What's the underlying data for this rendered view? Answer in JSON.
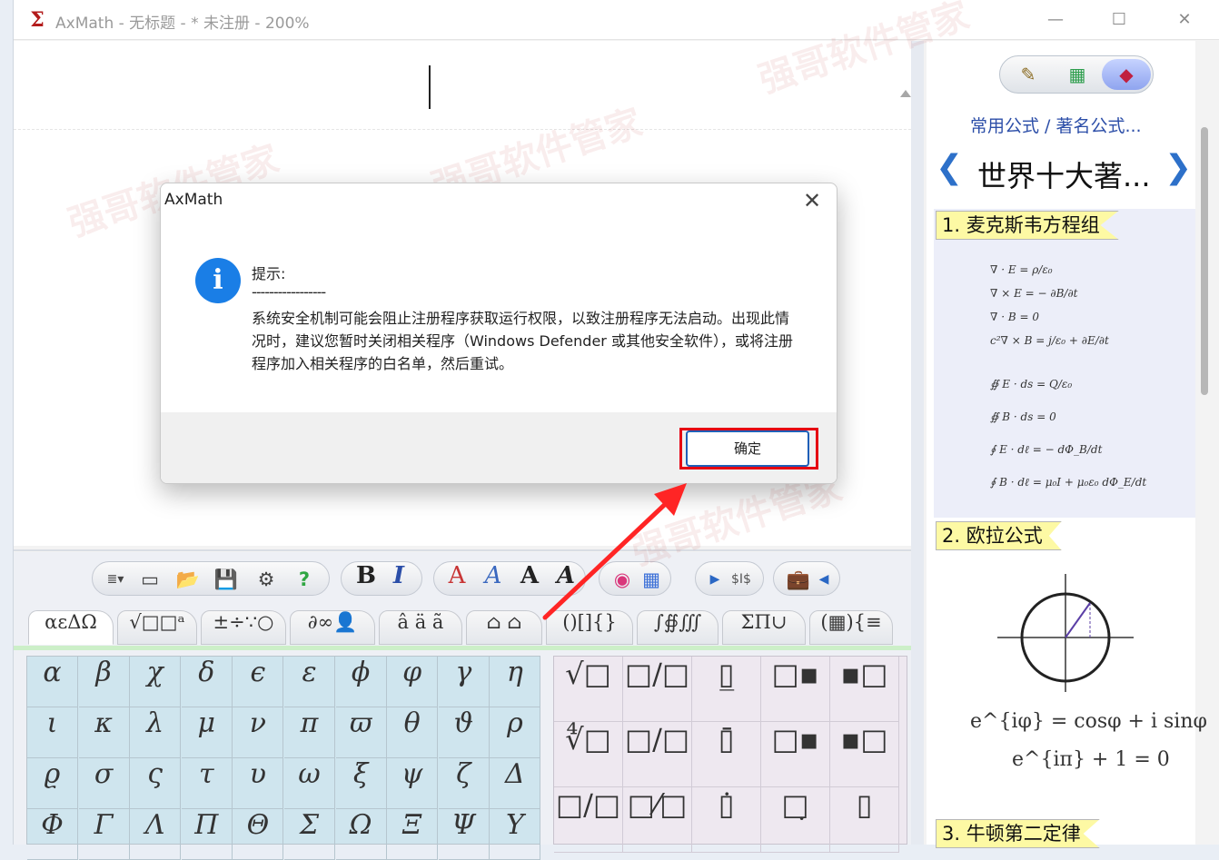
{
  "window": {
    "title": "AxMath - 无标题 - * 未注册 - 200%",
    "app_icon": "sigma-icon",
    "minimize": "—",
    "maximize": "☐",
    "close": "✕"
  },
  "sidebar": {
    "header": "常用公式 / 著名公式...",
    "category": "世界十大著...",
    "prev": "❮",
    "next": "❯",
    "mode_buttons": [
      "brush-icon",
      "grid-icon",
      "pen-icon"
    ],
    "items": [
      {
        "title": "1. 麦克斯韦方程组",
        "lines": [
          "∇ · E = ρ/ε₀",
          "∇ × E = − ∂B/∂t",
          "∇ · B = 0",
          "c²∇ × B = j/ε₀ + ∂E/∂t",
          "∯ E · ds = Q/ε₀",
          "∯ B · ds = 0",
          "∮ E · dℓ = − dΦ_B/dt",
          "∮ B · dℓ = μ₀I + μ₀ε₀ dΦ_E/dt"
        ]
      },
      {
        "title": "2. 欧拉公式",
        "lines": [
          "e^{iφ} = cosφ + i sinφ",
          "e^{iπ} + 1 = 0"
        ]
      },
      {
        "title": "3. 牛顿第二定律",
        "lines": []
      }
    ]
  },
  "toolbar": {
    "groups": [
      [
        "≣▾",
        "▭",
        "📂",
        "💾",
        "⚙",
        "?"
      ],
      [
        "B",
        "I"
      ],
      [
        "A",
        "A",
        "A",
        "A"
      ],
      [
        "◉",
        "▦"
      ],
      [
        "▶",
        "$I$"
      ],
      [
        "💼",
        "◀"
      ]
    ]
  },
  "tabs": [
    "αεΔΩ",
    "√□□ᵃ",
    "±÷∵○",
    "∂∞👤",
    "â ä ã",
    "⌂ ⌂",
    "()[]{}",
    "∫∯∭",
    "ΣΠ∪",
    "(▦){≡"
  ],
  "greek_symbols": [
    [
      "α",
      "β",
      "χ",
      "δ",
      "ϵ",
      "ε",
      "ϕ",
      "φ",
      "γ",
      "η"
    ],
    [
      "ι",
      "κ",
      "λ",
      "μ",
      "ν",
      "π",
      "ϖ",
      "θ",
      "ϑ",
      "ρ"
    ],
    [
      "ϱ",
      "σ",
      "ς",
      "τ",
      "υ",
      "ω",
      "ξ",
      "ψ",
      "ζ",
      "Δ"
    ],
    [
      "Φ",
      "Γ",
      "Λ",
      "Π",
      "Θ",
      "Σ",
      "Ω",
      "Ξ",
      "Ψ",
      "Υ"
    ]
  ],
  "templates": [
    [
      "√□",
      "□/□",
      "▯̲",
      "□▪",
      "▪□"
    ],
    [
      "∜□",
      "□/□",
      "▯̄",
      "□▪",
      "▪□"
    ],
    [
      "□/□",
      "□⁄□",
      "▯̇",
      "□̣",
      "▯"
    ]
  ],
  "dialog": {
    "title": "AxMath",
    "close": "✕",
    "icon": "i",
    "heading": "提示:",
    "separator": "-----------------",
    "message": "系统安全机制可能会阻止注册程序获取运行权限，以致注册程序无法启动。出现此情况时，建议您暂时关闭相关程序（Windows Defender 或其他安全软件），或将注册程序加入相关程序的白名单，然后重试。",
    "ok": "确定"
  },
  "watermark": "强哥软件管家",
  "colors": {
    "accent": "#1a7ee6",
    "highlight": "#e60012",
    "formula_title": "#fdf9a4"
  }
}
